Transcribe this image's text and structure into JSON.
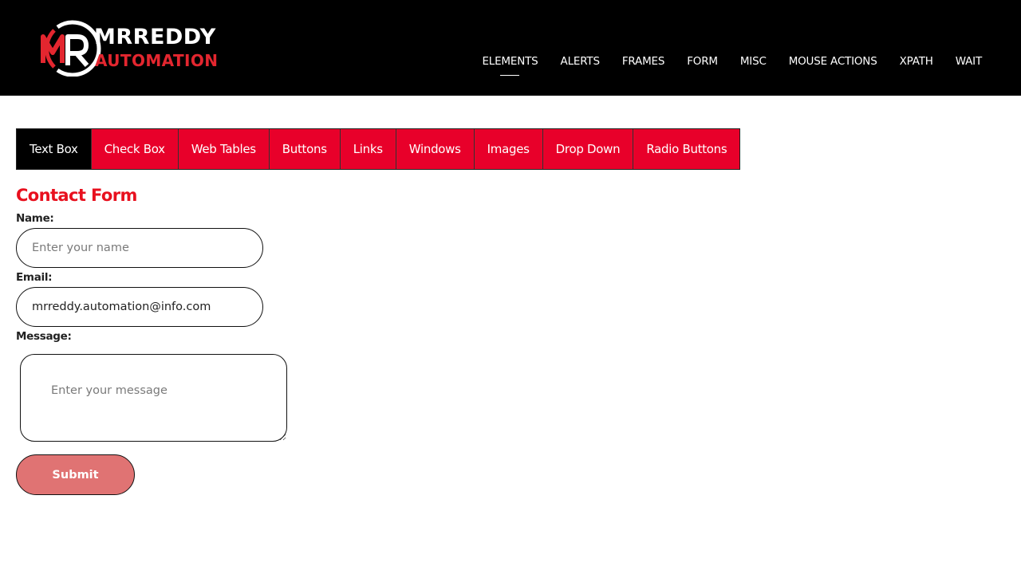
{
  "header": {
    "logo": {
      "mark": "MR",
      "line1": "MRREDDY",
      "line2": "AUTOMATION",
      "accent_color": "#e3262f"
    },
    "nav": [
      {
        "label": "ELEMENTS",
        "active": true
      },
      {
        "label": "ALERTS"
      },
      {
        "label": "FRAMES"
      },
      {
        "label": "FORM"
      },
      {
        "label": "MISC"
      },
      {
        "label": "MOUSE ACTIONS"
      },
      {
        "label": "XPATH"
      },
      {
        "label": "WAIT"
      }
    ]
  },
  "tabs": [
    {
      "label": "Text Box",
      "active": true
    },
    {
      "label": "Check Box"
    },
    {
      "label": "Web Tables"
    },
    {
      "label": "Buttons"
    },
    {
      "label": "Links"
    },
    {
      "label": "Windows"
    },
    {
      "label": "Images"
    },
    {
      "label": "Drop Down"
    },
    {
      "label": "Radio Buttons"
    }
  ],
  "form": {
    "title": "Contact Form",
    "name": {
      "label": "Name:",
      "placeholder": "Enter your name",
      "value": ""
    },
    "email": {
      "label": "Email:",
      "placeholder": "",
      "value": "mrreddy.automation@info.com"
    },
    "message": {
      "label": "Message:",
      "placeholder": "Enter your message",
      "value": ""
    },
    "submit_label": "Submit"
  },
  "colors": {
    "header_bg": "#000000",
    "tab_bg": "#e8002a",
    "tab_active_bg": "#000000",
    "title_color": "#e8101e",
    "submit_bg": "#e07373"
  }
}
